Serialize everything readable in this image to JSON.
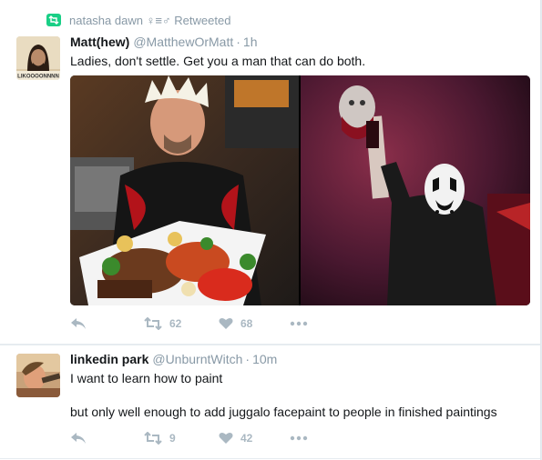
{
  "tweet1": {
    "retweeted_by": "natasha dawn ♀≡♂",
    "retweeted_label": "Retweeted",
    "author_name": "Matt(hew)",
    "author_handle": "@MatthewOrMatt",
    "separator": "·",
    "time": "1h",
    "text": "Ladies, don't settle. Get you a man that can do both.",
    "retweets": "62",
    "likes": "68",
    "avatar_caption": "LIKOOOONNNN"
  },
  "tweet2": {
    "author_name": "linkedin park",
    "author_handle": "@UnburntWitch",
    "separator": "·",
    "time": "10m",
    "text_line1": "I want to learn how to paint",
    "text_line2": "but only well enough to add juggalo facepaint to people in finished paintings",
    "retweets": "9",
    "likes": "42"
  },
  "icons": [
    "retweet-badge-icon",
    "reply-icon",
    "retweet-icon",
    "heart-icon",
    "more-icon"
  ],
  "colors": {
    "retweet_green": "#19cf86",
    "muted_text": "#8899a6",
    "action_gray": "#aab8c2",
    "background": "#ffffff"
  }
}
